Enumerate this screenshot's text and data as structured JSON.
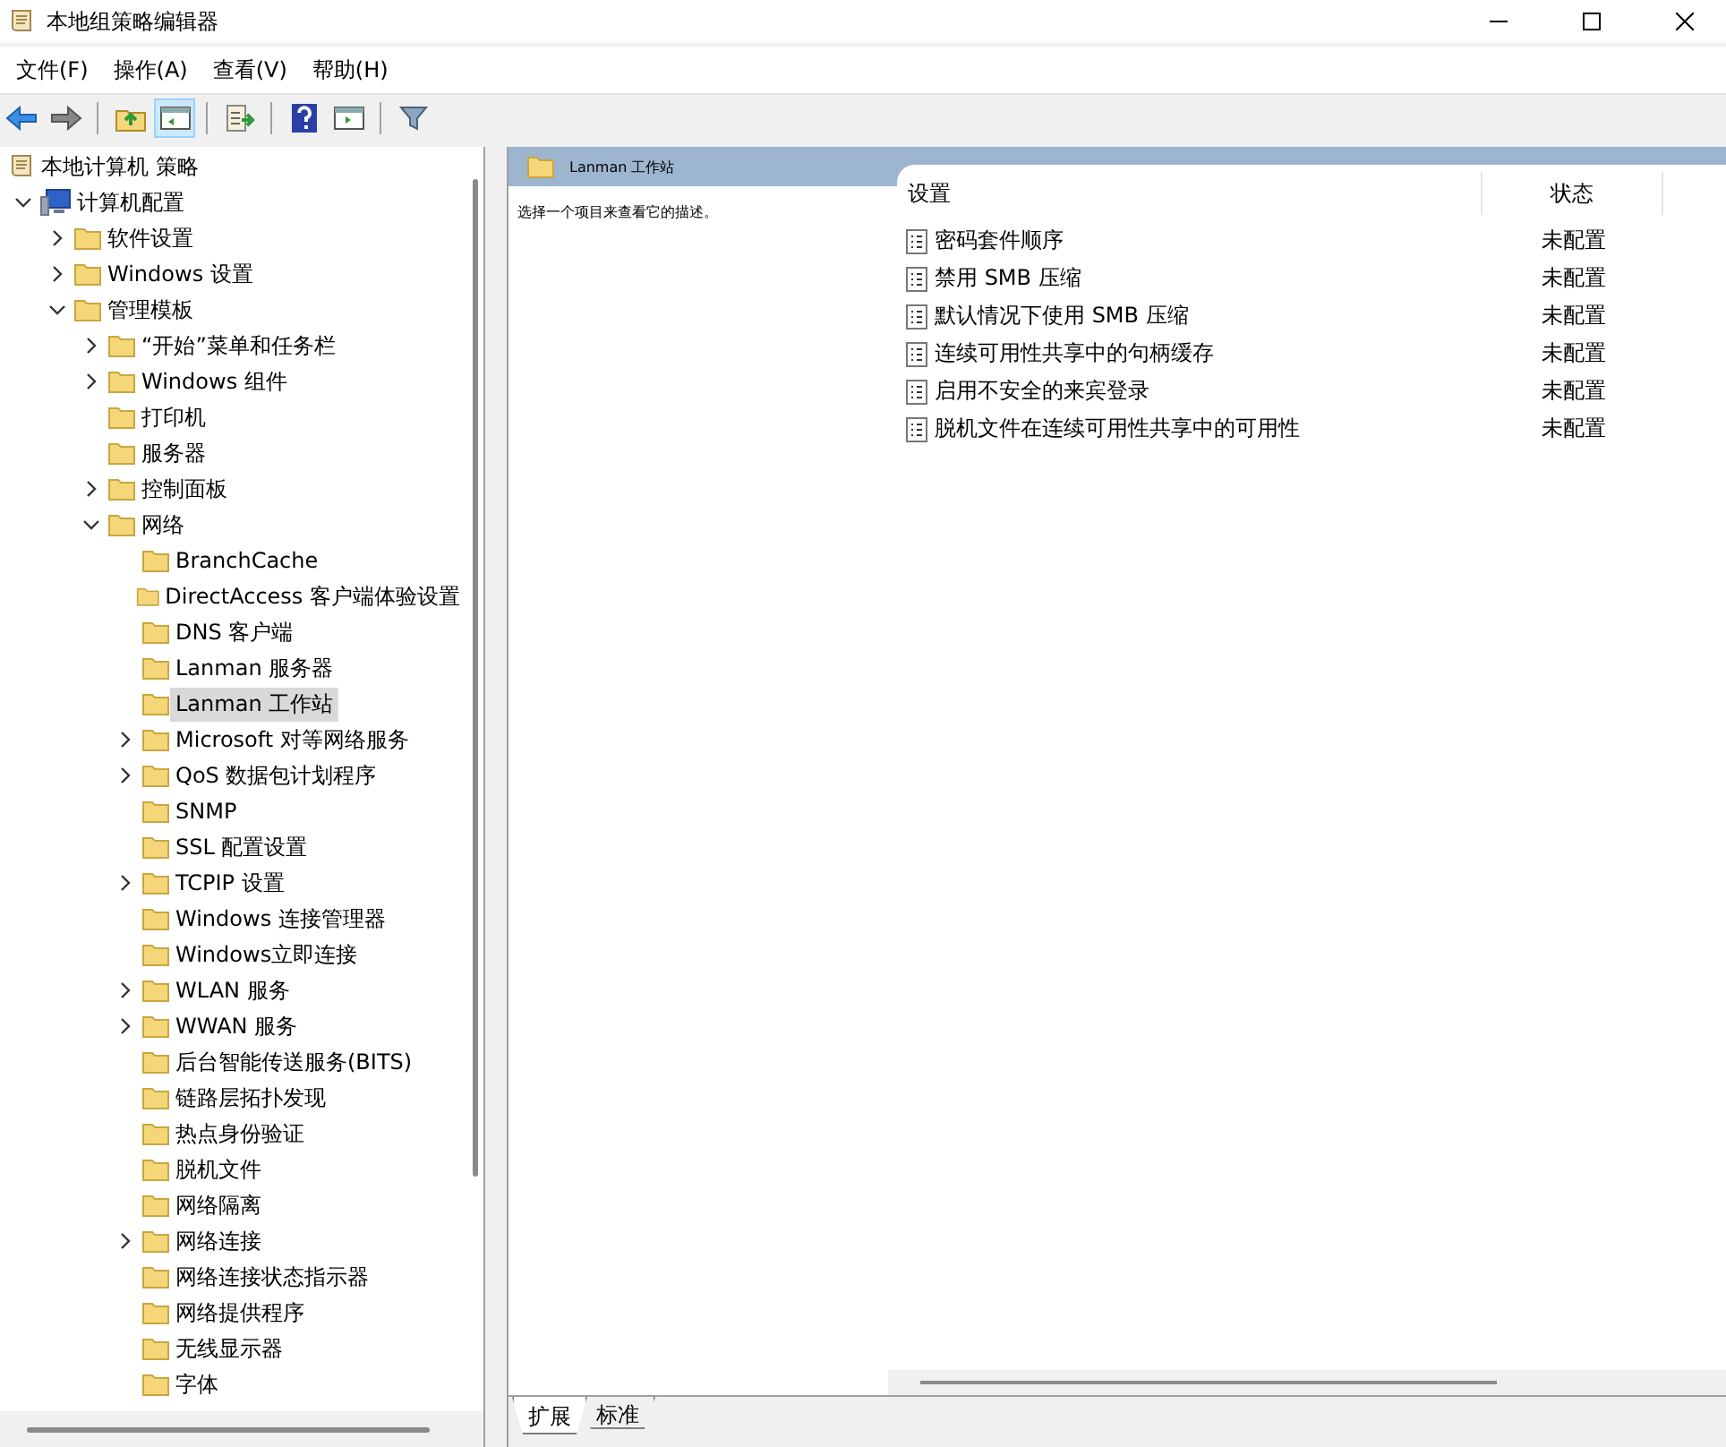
{
  "window": {
    "title": "本地组策略编辑器"
  },
  "menu": [
    "文件(F)",
    "操作(A)",
    "查看(V)",
    "帮助(H)"
  ],
  "toolbar": [
    {
      "kind": "back",
      "pressed": false
    },
    {
      "kind": "forward",
      "pressed": false
    },
    {
      "kind": "sep"
    },
    {
      "kind": "up",
      "pressed": false
    },
    {
      "kind": "pane",
      "pressed": true
    },
    {
      "kind": "sep"
    },
    {
      "kind": "export",
      "pressed": false
    },
    {
      "kind": "sep"
    },
    {
      "kind": "help",
      "pressed": false
    },
    {
      "kind": "view",
      "pressed": false
    },
    {
      "kind": "sep"
    },
    {
      "kind": "filter",
      "pressed": false
    }
  ],
  "tree": [
    {
      "label": "本地计算机 策略",
      "kind": "policy",
      "selected": false,
      "children": [
        {
          "label": "计算机配置",
          "kind": "computer",
          "expanded": true,
          "selected": false,
          "children": [
            {
              "label": "软件设置",
              "kind": "folder",
              "expanded": false,
              "selected": false
            },
            {
              "label": "Windows 设置",
              "kind": "folder",
              "expanded": false,
              "selected": false
            },
            {
              "label": "管理模板",
              "kind": "folder",
              "expanded": true,
              "selected": false,
              "children": [
                {
                  "label": "“开始”菜单和任务栏",
                  "kind": "folder",
                  "expanded": false,
                  "selected": false
                },
                {
                  "label": "Windows 组件",
                  "kind": "folder",
                  "expanded": false,
                  "selected": false
                },
                {
                  "label": "打印机",
                  "kind": "folder",
                  "selected": false
                },
                {
                  "label": "服务器",
                  "kind": "folder",
                  "selected": false
                },
                {
                  "label": "控制面板",
                  "kind": "folder",
                  "expanded": false,
                  "selected": false
                },
                {
                  "label": "网络",
                  "kind": "folder",
                  "expanded": true,
                  "selected": false,
                  "children": [
                    {
                      "label": "BranchCache",
                      "kind": "folder",
                      "selected": false
                    },
                    {
                      "label": "DirectAccess 客户端体验设置",
                      "kind": "folder",
                      "selected": false
                    },
                    {
                      "label": "DNS 客户端",
                      "kind": "folder",
                      "selected": false
                    },
                    {
                      "label": "Lanman 服务器",
                      "kind": "folder",
                      "selected": false
                    },
                    {
                      "label": "Lanman 工作站",
                      "kind": "folder",
                      "selected": true
                    },
                    {
                      "label": "Microsoft 对等网络服务",
                      "kind": "folder",
                      "expanded": false,
                      "selected": false
                    },
                    {
                      "label": "QoS 数据包计划程序",
                      "kind": "folder",
                      "expanded": false,
                      "selected": false
                    },
                    {
                      "label": "SNMP",
                      "kind": "folder",
                      "selected": false
                    },
                    {
                      "label": "SSL 配置设置",
                      "kind": "folder",
                      "selected": false
                    },
                    {
                      "label": "TCPIP 设置",
                      "kind": "folder",
                      "expanded": false,
                      "selected": false
                    },
                    {
                      "label": "Windows 连接管理器",
                      "kind": "folder",
                      "selected": false
                    },
                    {
                      "label": "Windows立即连接",
                      "kind": "folder",
                      "selected": false
                    },
                    {
                      "label": "WLAN 服务",
                      "kind": "folder",
                      "expanded": false,
                      "selected": false
                    },
                    {
                      "label": "WWAN 服务",
                      "kind": "folder",
                      "expanded": false,
                      "selected": false
                    },
                    {
                      "label": "后台智能传送服务(BITS)",
                      "kind": "folder",
                      "selected": false
                    },
                    {
                      "label": "链路层拓扑发现",
                      "kind": "folder",
                      "selected": false
                    },
                    {
                      "label": "热点身份验证",
                      "kind": "folder",
                      "selected": false
                    },
                    {
                      "label": "脱机文件",
                      "kind": "folder",
                      "selected": false
                    },
                    {
                      "label": "网络隔离",
                      "kind": "folder",
                      "selected": false
                    },
                    {
                      "label": "网络连接",
                      "kind": "folder",
                      "expanded": false,
                      "selected": false
                    },
                    {
                      "label": "网络连接状态指示器",
                      "kind": "folder",
                      "selected": false
                    },
                    {
                      "label": "网络提供程序",
                      "kind": "folder",
                      "selected": false
                    },
                    {
                      "label": "无线显示器",
                      "kind": "folder",
                      "selected": false
                    },
                    {
                      "label": "字体",
                      "kind": "folder",
                      "selected": false
                    }
                  ]
                }
              ]
            }
          ]
        }
      ]
    }
  ],
  "details": {
    "heading": "Lanman 工作站",
    "description": "选择一个项目来查看它的描述。",
    "columns": [
      "设置",
      "状态"
    ],
    "rows": [
      {
        "setting": "密码套件顺序",
        "state": "未配置"
      },
      {
        "setting": "禁用 SMB 压缩",
        "state": "未配置"
      },
      {
        "setting": "默认情况下使用 SMB 压缩",
        "state": "未配置"
      },
      {
        "setting": "连续可用性共享中的句柄缓存",
        "state": "未配置"
      },
      {
        "setting": "启用不安全的来宾登录",
        "state": "未配置"
      },
      {
        "setting": "脱机文件在连续可用性共享中的可用性",
        "state": "未配置"
      }
    ]
  },
  "view_tabs": [
    {
      "label": "扩展",
      "selected": true
    },
    {
      "label": "标准",
      "selected": false
    }
  ]
}
